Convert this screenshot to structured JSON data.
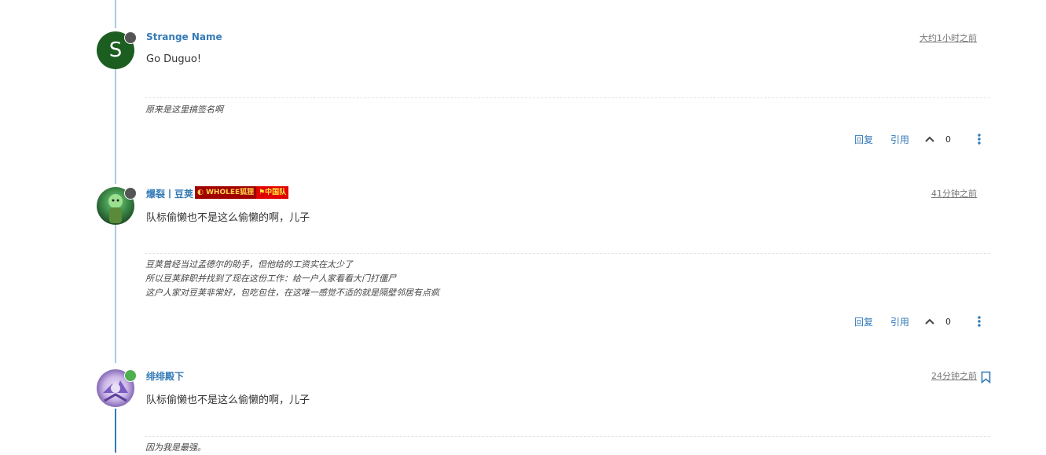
{
  "posts": [
    {
      "username": "Strange Name",
      "avatar_letter": "S",
      "timestamp": "大约1小时之前",
      "content": "Go Duguo!",
      "signature": [
        "原来是这里搞签名啊"
      ],
      "reply_label": "回复",
      "quote_label": "引用",
      "votes": "0",
      "status_color": "#555555"
    },
    {
      "username": "爆裂丨豆荚",
      "badges": [
        "WHOLEE狐狸",
        "中国队"
      ],
      "timestamp": "41分钟之前",
      "content": "队标偷懒也不是这么偷懒的啊，儿子",
      "signature": [
        "豆荚曾经当过孟德尔的助手，但他给的工资实在太少了",
        "所以豆荚辞职并找到了现在这份工作：给一户人家看看大门打僵尸",
        "这户人家对豆荚非常好，包吃包住，在这唯一感觉不适的就是隔壁邻居有点疯"
      ],
      "reply_label": "回复",
      "quote_label": "引用",
      "votes": "0",
      "status_color": "#555555"
    },
    {
      "username": "绯绯殿下",
      "timestamp": "24分钟之前",
      "content": "队标偷懒也不是这么偷懒的啊，儿子",
      "signature": [
        "因为我是最强。"
      ],
      "status_color": "#4caf50"
    }
  ],
  "colors": {
    "link": "#337ab7",
    "timeline": "#9cc4e4",
    "timeline_active": "#337ab7",
    "badge_red": "#a00000",
    "badge_bright_red": "#e00000"
  }
}
